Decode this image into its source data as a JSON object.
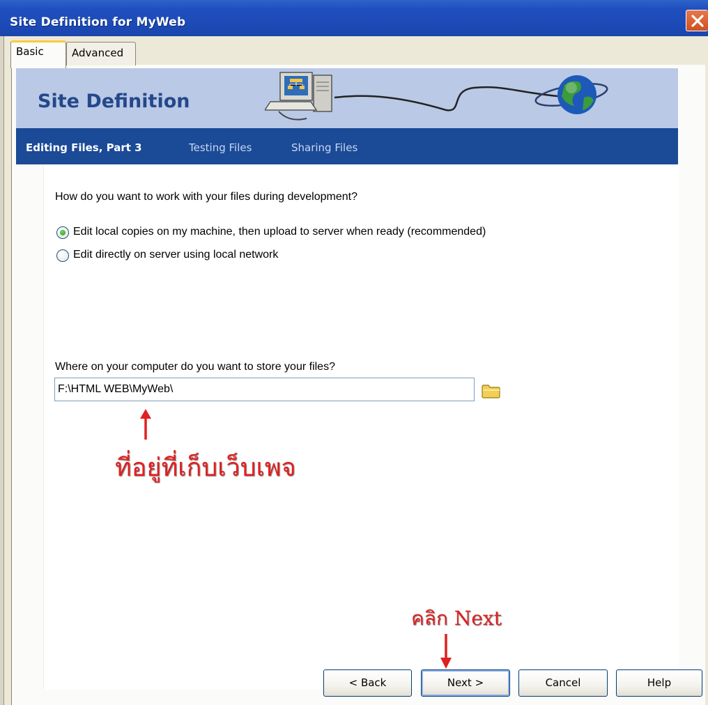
{
  "window": {
    "title": "Site Definition for MyWeb",
    "close_icon": "close-icon"
  },
  "tabs": [
    {
      "label": "Basic",
      "selected": true
    },
    {
      "label": "Advanced",
      "selected": false
    }
  ],
  "banner": {
    "title": "Site Definition",
    "art_icons": [
      "computer-icon",
      "globe-icon"
    ]
  },
  "steps": {
    "active": "Editing Files, Part 3",
    "items": [
      "Testing Files",
      "Sharing Files"
    ]
  },
  "form": {
    "question": "How do you want to work with your files during development?",
    "options": [
      {
        "label": "Edit local copies on my machine, then upload to server when ready (recommended)",
        "selected": true
      },
      {
        "label": "Edit directly on server using local network",
        "selected": false
      }
    ],
    "store_question": "Where on your computer do you want to store your files?",
    "path_value": "F:\\HTML WEB\\MyWeb\\",
    "browse_icon": "folder-icon"
  },
  "annotations": {
    "path_note": "ที่อยู่ที่เก็บเว็บเพจ",
    "click_note": "คลิก Next",
    "color": "#e02020"
  },
  "buttons": {
    "back": "< Back",
    "next": "Next >",
    "cancel": "Cancel",
    "help": "Help"
  }
}
